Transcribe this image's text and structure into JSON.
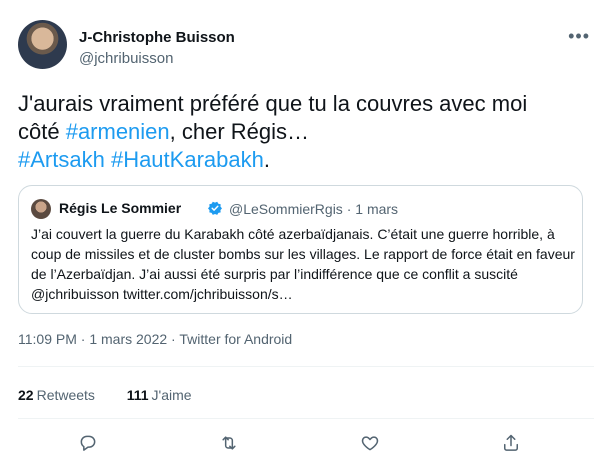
{
  "author": {
    "name": "J-Christophe Buisson",
    "handle": "@jchribuisson"
  },
  "tweet": {
    "line1": "J'aurais vraiment préféré que tu la couvres avec moi",
    "line2_prefix": "côté ",
    "hashtag_armenien": "#armenien",
    "line2_suffix": ", cher Régis…",
    "hashtag_artsakh": "#Artsakh",
    "hashtag_haut": "#HautKarabakh",
    "line3_suffix": "."
  },
  "quoted": {
    "name": "Régis Le Sommier",
    "handle": "@LeSommierRgis",
    "separator": " · ",
    "date": "1 mars",
    "text": "J’ai couvert la guerre du Karabakh côté azerbaïdjanais. C’était une guerre horrible, à coup de missiles et de cluster bombs sur les villages. Le rapport de force était en faveur de l’Azerbaïdjan. J’ai aussi été surpris par l’indifférence que ce conflit a suscité @jchribuisson twitter.com/jchribuisson/s…"
  },
  "meta": {
    "time": "11:09 PM",
    "date": "1 mars 2022",
    "source": "Twitter for Android",
    "sep": " · "
  },
  "stats": {
    "retweets_count": "22",
    "retweets_label": "Retweets",
    "likes_count": "111",
    "likes_label": "J'aime"
  },
  "icons": [
    "more-icon",
    "verified-icon",
    "reply-icon",
    "retweet-icon",
    "like-icon",
    "share-icon"
  ],
  "colors": {
    "link": "#1d9bf0",
    "secondary_text": "#536471",
    "border": "#cfd9de"
  }
}
